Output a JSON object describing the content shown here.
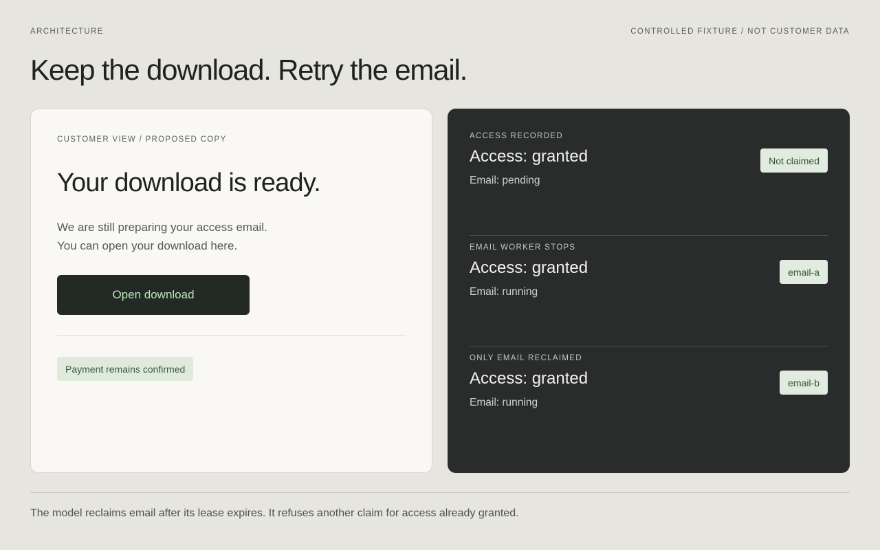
{
  "header": {
    "section_label": "ARCHITECTURE",
    "fixture_label": "CONTROLLED FIXTURE / NOT CUSTOMER DATA",
    "headline": "Keep the download. Retry the email."
  },
  "customer_card": {
    "label": "CUSTOMER VIEW / PROPOSED COPY",
    "title": "Your download is ready.",
    "body_line_1": "We are still preparing your access email.",
    "body_line_2": "You can open your download here.",
    "button_label": "Open download",
    "payment_badge": "Payment remains confirmed"
  },
  "states": [
    {
      "label": "ACCESS RECORDED",
      "access": "Access: granted",
      "email": "Email: pending",
      "badge": "Not claimed"
    },
    {
      "label": "EMAIL WORKER STOPS",
      "access": "Access: granted",
      "email": "Email: running",
      "badge": "email-a"
    },
    {
      "label": "ONLY EMAIL RECLAIMED",
      "access": "Access: granted",
      "email": "Email: running",
      "badge": "email-b"
    }
  ],
  "footer": {
    "note": "The model reclaims email after its lease expires. It refuses another claim for access already granted."
  },
  "colors": {
    "background": "#e6e5df",
    "light_card": "#f9f8f4",
    "dark_card": "#2a2c2b",
    "button_bg": "#232a25",
    "button_text": "#b9e6b9",
    "badge_bg": "#dfeadd"
  }
}
